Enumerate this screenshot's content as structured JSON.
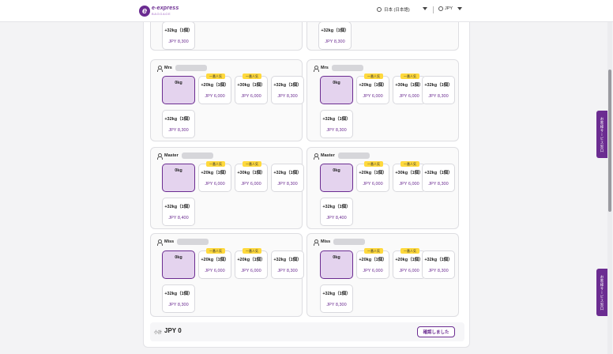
{
  "header": {
    "logo_text": "e-express",
    "logo_sub": "BAGGAGE",
    "region": "日本 (日本語)",
    "currency": "JPY"
  },
  "passengers": [
    {
      "title": "Mrs"
    },
    {
      "title": "Mrs"
    },
    {
      "title": "Master"
    },
    {
      "title": "Master"
    },
    {
      "title": "Miss"
    },
    {
      "title": "Miss"
    }
  ],
  "options": {
    "zero": {
      "label": "0kg"
    },
    "o20": {
      "label": "+20kg（1個）",
      "price": "JPY 6,000"
    },
    "o30": {
      "label": "+30kg（1個）",
      "price": "JPY 6,000"
    },
    "o32": {
      "label": "+32kg（1個）",
      "price": "JPY 8,300"
    },
    "o32b": {
      "label": "+32kg（1個）",
      "price": "JPY 8,400"
    },
    "popular_badge": "一番人気"
  },
  "footer": {
    "subtotal_label": "小計",
    "subtotal_value": "JPY 0",
    "confirm_label": "確認しました"
  },
  "side_tabs": {
    "tab1": "お客様サービス窓口",
    "tab2": "お客様サービス窓口"
  },
  "colors": {
    "brand": "#6b2c91",
    "selected_bg": "#e4d3ee",
    "badge": "#ffd93d"
  }
}
